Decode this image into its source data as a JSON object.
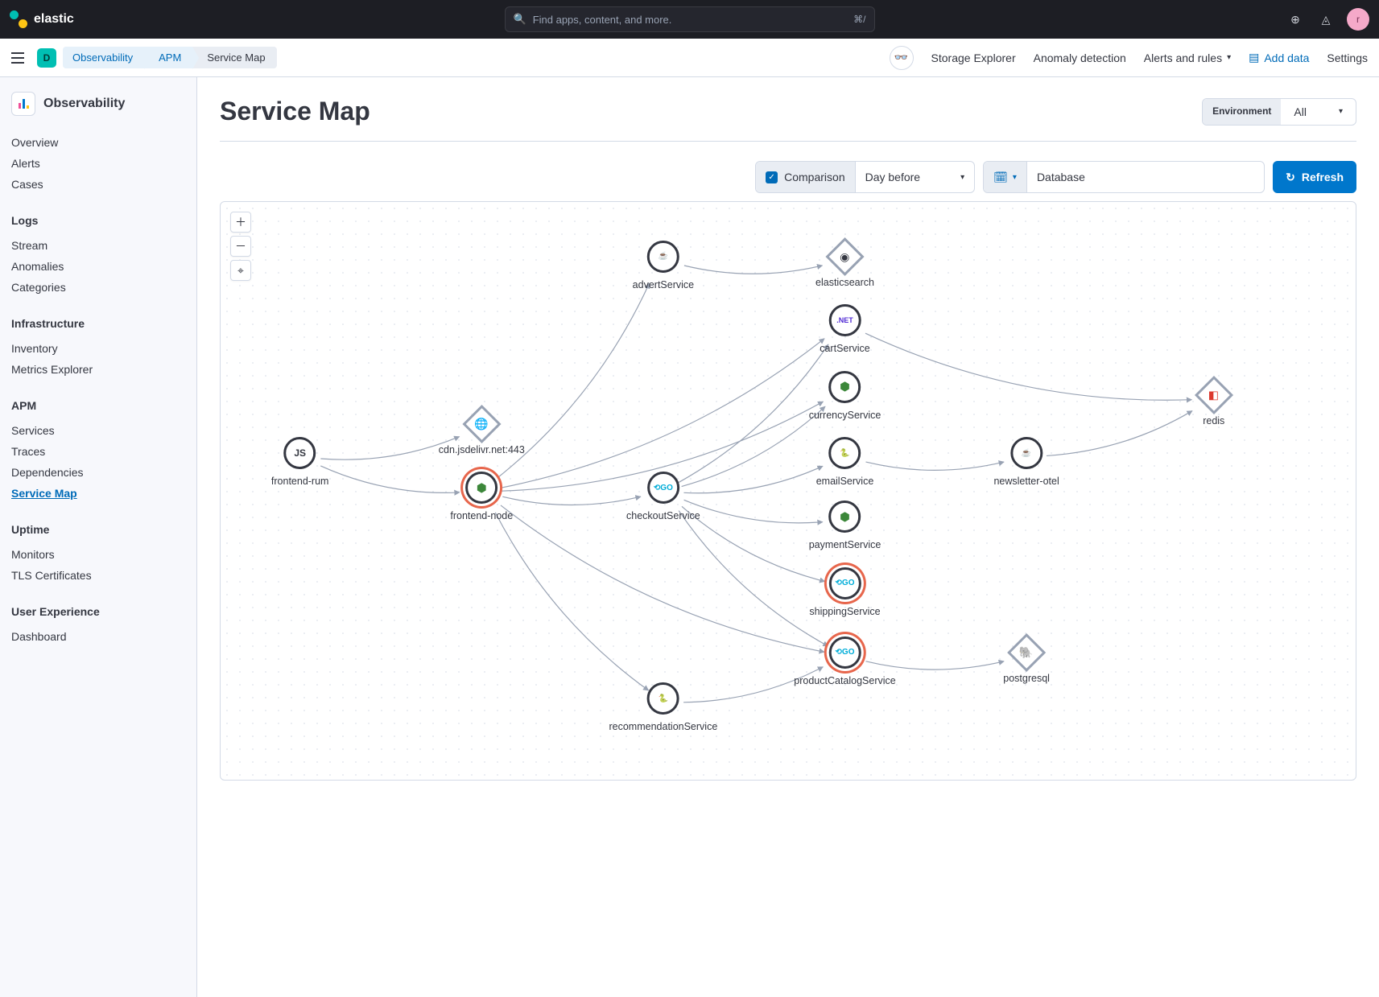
{
  "header": {
    "brand": "elastic",
    "search_placeholder": "Find apps, content, and more.",
    "search_shortcut": "⌘/",
    "space_letter": "D",
    "avatar_letter": "r"
  },
  "breadcrumbs": [
    "Observability",
    "APM",
    "Service Map"
  ],
  "subheader_links": {
    "storage_explorer": "Storage Explorer",
    "anomaly_detection": "Anomaly detection",
    "alerts_rules": "Alerts and rules",
    "add_data": "Add data",
    "settings": "Settings"
  },
  "sidebar": {
    "title": "Observability",
    "top_items": [
      "Overview",
      "Alerts",
      "Cases"
    ],
    "groups": [
      {
        "title": "Logs",
        "items": [
          "Stream",
          "Anomalies",
          "Categories"
        ]
      },
      {
        "title": "Infrastructure",
        "items": [
          "Inventory",
          "Metrics Explorer"
        ]
      },
      {
        "title": "APM",
        "items": [
          "Services",
          "Traces",
          "Dependencies",
          "Service Map"
        ],
        "active": "Service Map"
      },
      {
        "title": "Uptime",
        "items": [
          "Monitors",
          "TLS Certificates"
        ]
      },
      {
        "title": "User Experience",
        "items": [
          "Dashboard"
        ]
      }
    ]
  },
  "page": {
    "title": "Service Map",
    "env_label": "Environment",
    "env_value": "All"
  },
  "filters": {
    "comparison_label": "Comparison",
    "comparison_value": "Day before",
    "search_value": "Database",
    "refresh": "Refresh"
  },
  "nodes": {
    "frontend_rum": {
      "label": "frontend-rum",
      "tech": "JS"
    },
    "cdn": {
      "label": "cdn.jsdelivr.net:443"
    },
    "frontend_node": {
      "label": "frontend-node"
    },
    "checkout": {
      "label": "checkoutService",
      "tech": "GO"
    },
    "advert": {
      "label": "advertService"
    },
    "elasticsearch": {
      "label": "elasticsearch"
    },
    "cart": {
      "label": "cartService",
      "tech": ".NET"
    },
    "currency": {
      "label": "currencyService"
    },
    "email": {
      "label": "emailService"
    },
    "newsletter": {
      "label": "newsletter-otel"
    },
    "payment": {
      "label": "paymentService"
    },
    "shipping": {
      "label": "shippingService",
      "tech": "GO"
    },
    "product": {
      "label": "productCatalogService",
      "tech": "GO"
    },
    "recommendation": {
      "label": "recommendationService"
    },
    "postgresql": {
      "label": "postgresql"
    },
    "redis": {
      "label": "redis"
    }
  },
  "edges": [
    [
      "frontend_rum",
      "cdn"
    ],
    [
      "frontend_rum",
      "frontend_node"
    ],
    [
      "frontend_node",
      "advert"
    ],
    [
      "frontend_node",
      "checkout"
    ],
    [
      "frontend_node",
      "cart"
    ],
    [
      "frontend_node",
      "currency"
    ],
    [
      "frontend_node",
      "product"
    ],
    [
      "frontend_node",
      "recommendation"
    ],
    [
      "checkout",
      "cart"
    ],
    [
      "checkout",
      "currency"
    ],
    [
      "checkout",
      "email"
    ],
    [
      "checkout",
      "payment"
    ],
    [
      "checkout",
      "shipping"
    ],
    [
      "checkout",
      "product"
    ],
    [
      "advert",
      "elasticsearch"
    ],
    [
      "email",
      "newsletter"
    ],
    [
      "product",
      "postgresql"
    ],
    [
      "recommendation",
      "product"
    ],
    [
      "cart",
      "redis"
    ],
    [
      "newsletter",
      "redis"
    ]
  ]
}
